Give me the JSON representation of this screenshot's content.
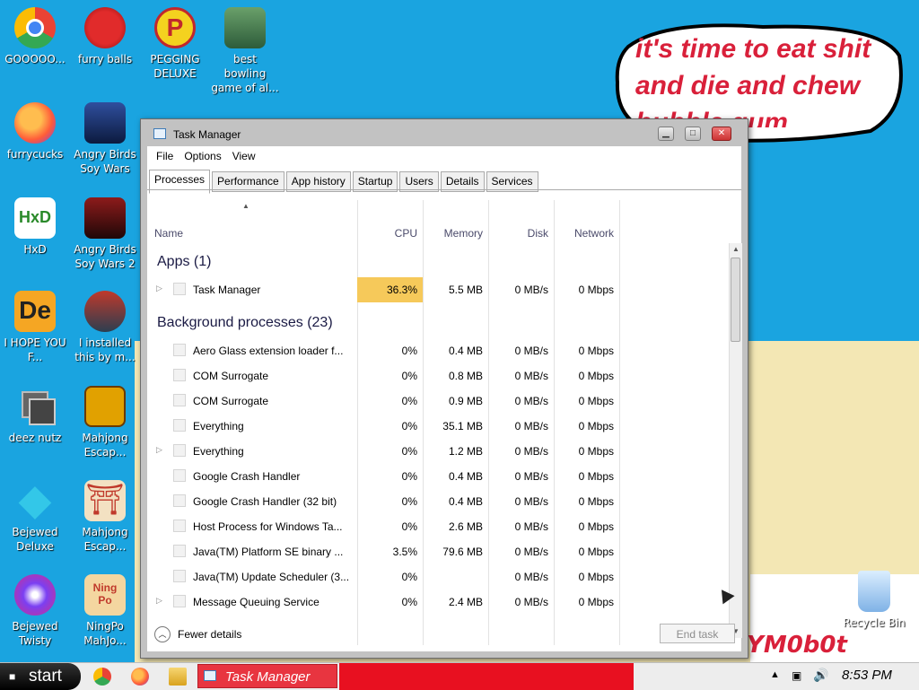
{
  "bubble_text": "it's time to eat shit and die and chew bubble gum",
  "desktop_overlay_text": "YM0b0t",
  "desktop_icons": [
    {
      "label": "GOOOOO..."
    },
    {
      "label": "furry balls"
    },
    {
      "label": "PEGGING DELUXE"
    },
    {
      "label": "best bowling game of al..."
    },
    {
      "label": "furrycucks"
    },
    {
      "label": "Angry Birds Soy Wars"
    },
    {
      "label": "HxD"
    },
    {
      "label": "Angry Birds Soy Wars 2"
    },
    {
      "label": "I HOPE YOU F..."
    },
    {
      "label": "I installed this by m..."
    },
    {
      "label": "deez nutz"
    },
    {
      "label": "Mahjong Escap..."
    },
    {
      "label": "Bejewed Deluxe"
    },
    {
      "label": "Mahjong Escap..."
    },
    {
      "label": "Bejewed Twisty"
    },
    {
      "label": "NingPo MahJo..."
    },
    {
      "label": "Recycle Bin"
    }
  ],
  "window": {
    "title": "Task Manager",
    "menu": [
      "File",
      "Options",
      "View"
    ],
    "tabs": [
      "Processes",
      "Performance",
      "App history",
      "Startup",
      "Users",
      "Details",
      "Services"
    ],
    "active_tab": "Processes",
    "columns": {
      "name": "Name",
      "cpu": "CPU",
      "memory": "Memory",
      "disk": "Disk",
      "network": "Network"
    },
    "apps_group": "Apps (1)",
    "bg_group": "Background processes (23)",
    "app_rows": [
      {
        "name": "Task Manager",
        "cpu": "36.3%",
        "mem": "5.5 MB",
        "disk": "0 MB/s",
        "net": "0 Mbps",
        "expandable": true
      }
    ],
    "bg_rows": [
      {
        "name": "Aero Glass extension loader f...",
        "cpu": "0%",
        "mem": "0.4 MB",
        "disk": "0 MB/s",
        "net": "0 Mbps",
        "expandable": false
      },
      {
        "name": "COM Surrogate",
        "cpu": "0%",
        "mem": "0.8 MB",
        "disk": "0 MB/s",
        "net": "0 Mbps",
        "expandable": false
      },
      {
        "name": "COM Surrogate",
        "cpu": "0%",
        "mem": "0.9 MB",
        "disk": "0 MB/s",
        "net": "0 Mbps",
        "expandable": false
      },
      {
        "name": "Everything",
        "cpu": "0%",
        "mem": "35.1 MB",
        "disk": "0 MB/s",
        "net": "0 Mbps",
        "expandable": false
      },
      {
        "name": "Everything",
        "cpu": "0%",
        "mem": "1.2 MB",
        "disk": "0 MB/s",
        "net": "0 Mbps",
        "expandable": true
      },
      {
        "name": "Google Crash Handler",
        "cpu": "0%",
        "mem": "0.4 MB",
        "disk": "0 MB/s",
        "net": "0 Mbps",
        "expandable": false
      },
      {
        "name": "Google Crash Handler (32 bit)",
        "cpu": "0%",
        "mem": "0.4 MB",
        "disk": "0 MB/s",
        "net": "0 Mbps",
        "expandable": false
      },
      {
        "name": "Host Process for Windows Ta...",
        "cpu": "0%",
        "mem": "2.6 MB",
        "disk": "0 MB/s",
        "net": "0 Mbps",
        "expandable": false
      },
      {
        "name": "Java(TM) Platform SE binary ...",
        "cpu": "3.5%",
        "mem": "79.6 MB",
        "disk": "0 MB/s",
        "net": "0 Mbps",
        "expandable": false
      },
      {
        "name": "Java(TM) Update Scheduler (3...",
        "cpu": "0%",
        "mem": "",
        "disk": "0 MB/s",
        "net": "0 Mbps",
        "expandable": false
      },
      {
        "name": "Message Queuing Service",
        "cpu": "0%",
        "mem": "2.4 MB",
        "disk": "0 MB/s",
        "net": "0 Mbps",
        "expandable": true
      }
    ],
    "fewer_details": "Fewer details",
    "end_task": "End task"
  },
  "taskbar": {
    "start_label": "start",
    "task_manager_label": "Task Manager",
    "clock": "8:53 PM"
  },
  "colors": {
    "desktop": "#1aa4e0",
    "cpu_highlight": "#f6c95a",
    "taskbar_task": "#e83540"
  }
}
